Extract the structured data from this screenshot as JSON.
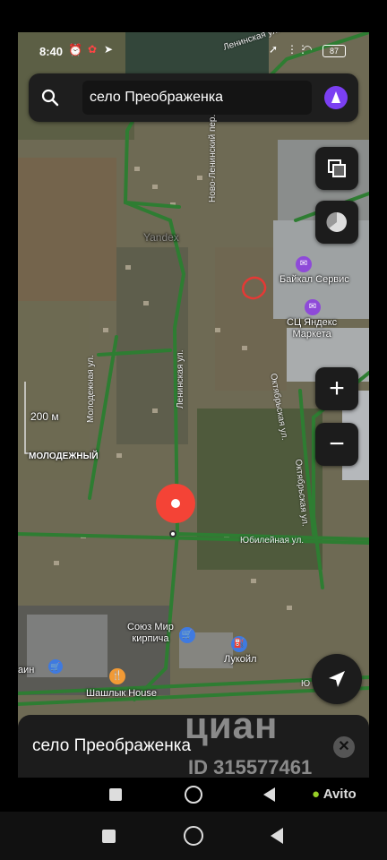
{
  "status_bar": {
    "time": "8:40",
    "battery": "87"
  },
  "search": {
    "value": "село Преображенка"
  },
  "map": {
    "scale_label": "200 м",
    "district_label": "МОЛОДЕЖНЫЙ",
    "yandex_mark": "Yandex",
    "streets": {
      "leninskaya_top": "Ленинская ул.",
      "novo_leninsky": "Ново-Ленинский пер.",
      "leninskaya": "Ленинская ул.",
      "molodezhnaya": "Молодежная ул.",
      "oktyabrskaya_1": "Октябрьская ул.",
      "oktyabrskaya_2": "Октябрьская ул.",
      "yubileynaya": "Юбилейная ул.",
      "edge": "Ю"
    },
    "pois": {
      "baikal": "Байкал Сервис",
      "yandex_market": "СЦ Яндекс\nМаркета",
      "soyuz": "Союз Мир\nкирпича",
      "lukoil": "Лукойл",
      "shashlyk": "Шашлык House",
      "magazin": "аин"
    }
  },
  "place": {
    "title": "село Преображенка"
  },
  "watermarks": {
    "cian": "циан",
    "id": "ID 315577461",
    "avito": "Avito"
  },
  "colors": {
    "road": "#2e7d32",
    "pin": "#f44336",
    "alice": "#7b3ff2"
  }
}
